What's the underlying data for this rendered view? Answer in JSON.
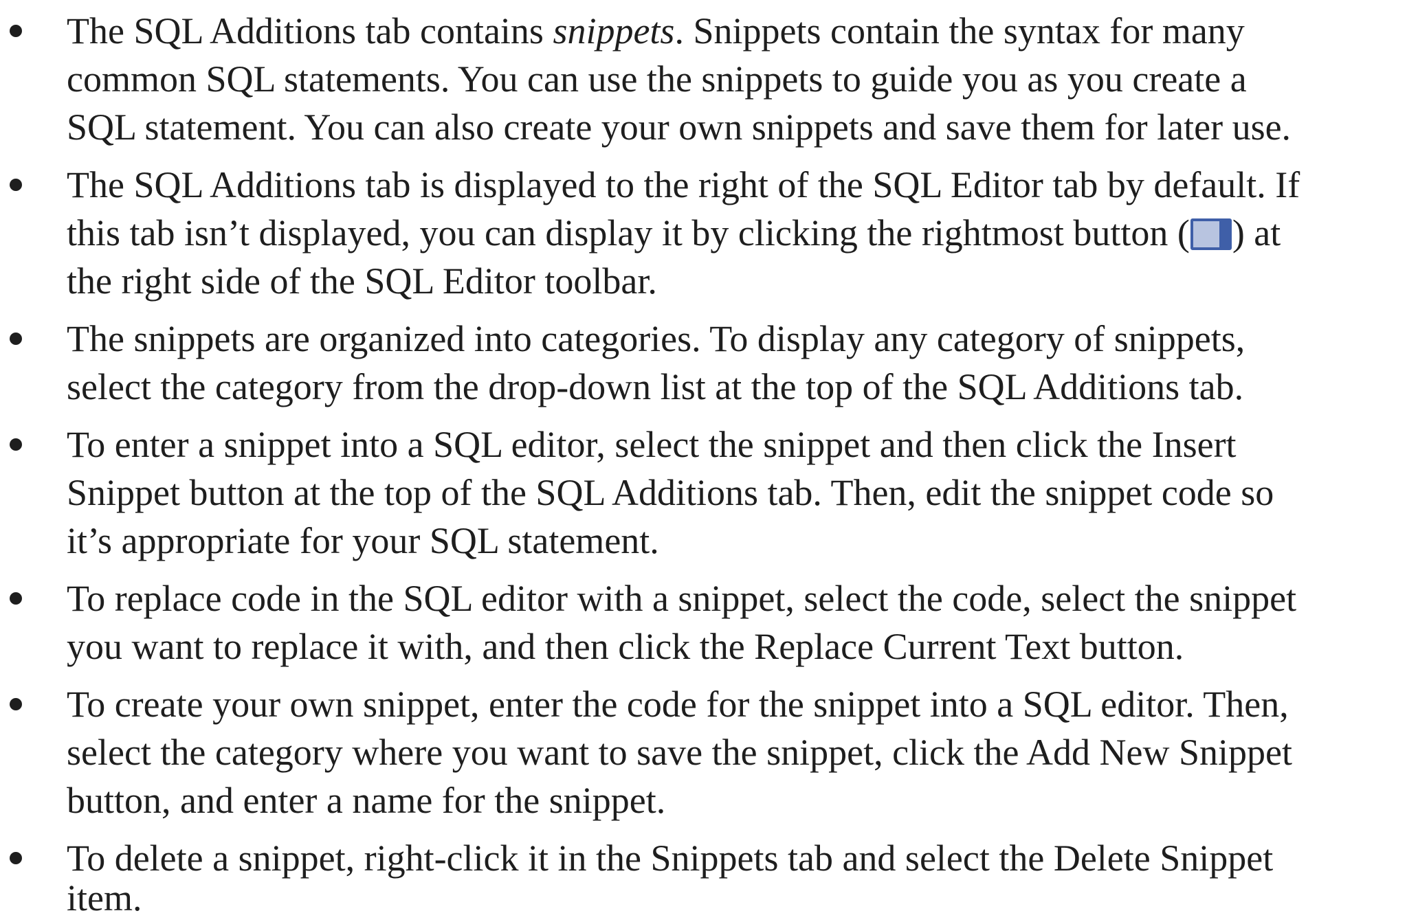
{
  "bullets": [
    {
      "lines": [
        [
          "The SQL Additions tab contains ",
          "snippets",
          ". Snippets contain the syntax for many"
        ],
        "common SQL statements. You can use the snippets to guide you as you create a",
        "SQL statement. You can also create your own snippets and save them for later use."
      ]
    },
    {
      "lines": [
        "The SQL Additions tab is displayed to the right of the SQL Editor tab by default. If",
        [
          "this tab isn’t displayed, you can display it by clicking the rightmost button (",
          ") at"
        ],
        "the right side of the SQL Editor toolbar."
      ]
    },
    {
      "lines": [
        "The snippets are organized into categories. To display any category of snippets,",
        "select the category from the drop-down list at the top of the SQL Additions tab."
      ]
    },
    {
      "lines": [
        "To enter a snippet into a SQL editor, select the snippet and then click the Insert",
        "Snippet button at the top of the SQL Additions tab. Then, edit the snippet code so",
        "it’s appropriate for your SQL statement."
      ]
    },
    {
      "lines": [
        "To replace code in the SQL editor with a snippet, select the code, select the snippet",
        "you want to replace it with, and then click the Replace Current Text button."
      ]
    },
    {
      "lines": [
        "To create your own snippet, enter the code for the snippet into a SQL editor. Then,",
        "select the category where you want to save the snippet, click the Add New Snippet",
        "button, and enter a name for the snippet."
      ]
    },
    {
      "lines": [
        "To delete a snippet, right-click it in the Snippets tab and select the Delete Snippet",
        "item."
      ]
    }
  ],
  "icons": {
    "toolbar_button": "toggle-sidebar-panel-icon",
    "accent_color": "#3f5fa8",
    "fill_color": "#b8c4e0"
  }
}
